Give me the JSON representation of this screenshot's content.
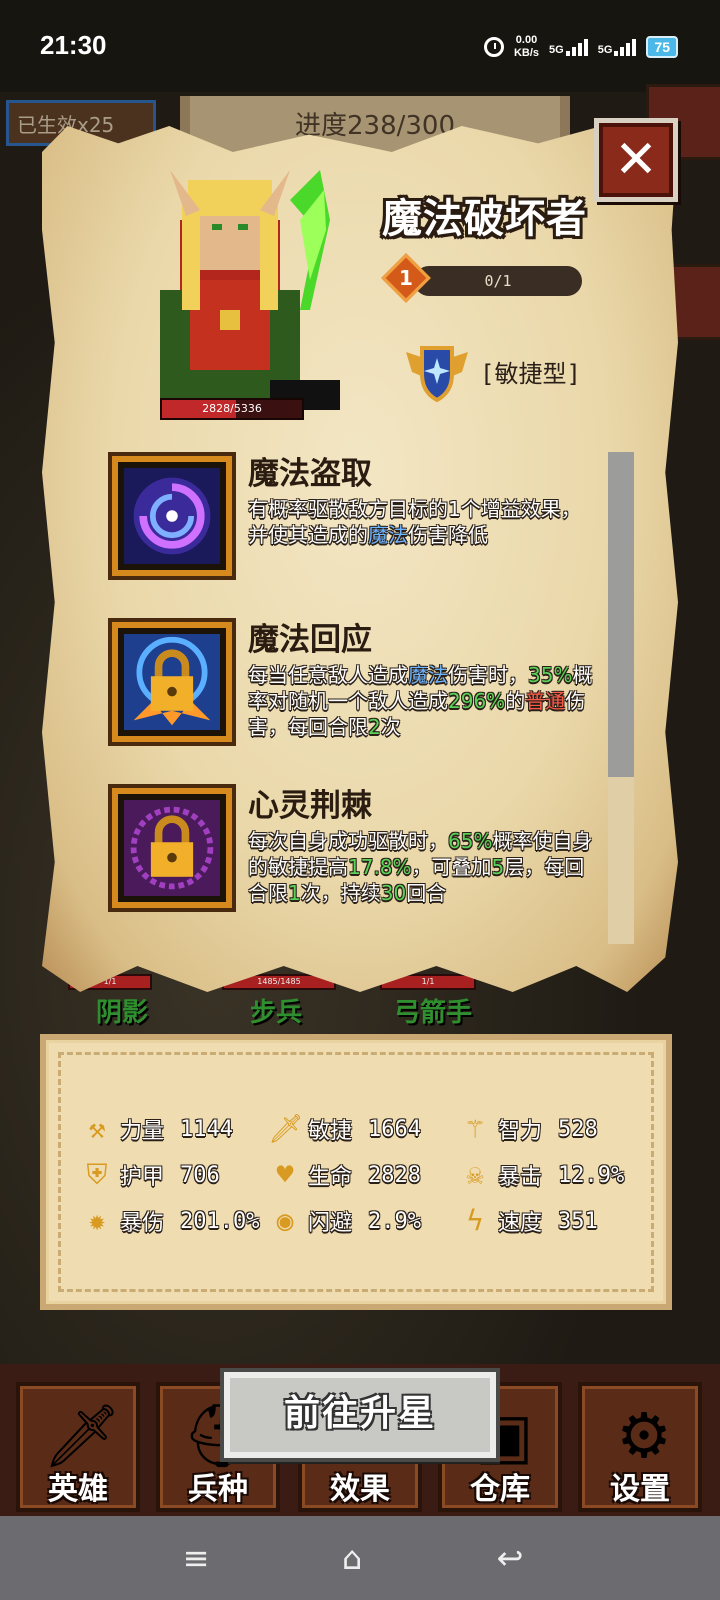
{
  "status_bar": {
    "time": "21:30",
    "net_speed_value": "0.00",
    "net_speed_unit": "KB/s",
    "signal1": "5G",
    "signal2": "5G",
    "battery": "75"
  },
  "background": {
    "effect_chip": "已生效x25",
    "progress_banner": "进度238/300",
    "units": [
      {
        "name": "阴影",
        "hp": "1/1"
      },
      {
        "name": "步兵",
        "hp": "1485/1485"
      },
      {
        "name": "弓箭手",
        "hp": "1/1"
      }
    ]
  },
  "hero": {
    "name": "魔法破坏者",
    "hp": "2828/5336",
    "hp_fraction": 0.53,
    "star_level": "1",
    "star_progress": "0/1",
    "type": "[敏捷型]"
  },
  "skills": [
    {
      "name": "魔法盗取",
      "icon": "galaxy-icon",
      "desc": [
        {
          "t": "有概率驱散敌方目标的1个增益效果，并使其造成的",
          "c": ""
        },
        {
          "t": "魔法",
          "c": "blue"
        },
        {
          "t": "伤害降低",
          "c": ""
        }
      ]
    },
    {
      "name": "魔法回应",
      "icon": "lock-burst-icon",
      "desc": [
        {
          "t": "每当任意敌人造成",
          "c": ""
        },
        {
          "t": "魔法",
          "c": "blue"
        },
        {
          "t": "伤害时，",
          "c": ""
        },
        {
          "t": "35%",
          "c": "green"
        },
        {
          "t": "概率对随机一个敌人造成",
          "c": ""
        },
        {
          "t": "296%",
          "c": "green"
        },
        {
          "t": "的",
          "c": ""
        },
        {
          "t": "普通",
          "c": "red"
        },
        {
          "t": "伤害，每回合限",
          "c": ""
        },
        {
          "t": "2",
          "c": "green"
        },
        {
          "t": "次",
          "c": ""
        }
      ]
    },
    {
      "name": "心灵荆棘",
      "icon": "lock-thorn-icon",
      "desc": [
        {
          "t": "每次自身成功驱散时，",
          "c": ""
        },
        {
          "t": "65%",
          "c": "green"
        },
        {
          "t": "概率使自身的敏捷提高",
          "c": ""
        },
        {
          "t": "17.8%",
          "c": "green"
        },
        {
          "t": "，可叠加",
          "c": ""
        },
        {
          "t": "5",
          "c": "green"
        },
        {
          "t": "层，每回合限",
          "c": ""
        },
        {
          "t": "1",
          "c": "green"
        },
        {
          "t": "次，持续",
          "c": ""
        },
        {
          "t": "30",
          "c": "green"
        },
        {
          "t": "回合",
          "c": ""
        }
      ]
    }
  ],
  "scroll_fraction_visible": 0.66,
  "stats": [
    {
      "label": "力量",
      "value": "1144",
      "icon": "axe-icon",
      "glyph": "⚒"
    },
    {
      "label": "敏捷",
      "value": "1664",
      "icon": "sword-icon",
      "glyph": "🗡"
    },
    {
      "label": "智力",
      "value": "528",
      "icon": "staff-icon",
      "glyph": "⚚"
    },
    {
      "label": "护甲",
      "value": "706",
      "icon": "shield-icon",
      "glyph": "⛨"
    },
    {
      "label": "生命",
      "value": "2828",
      "icon": "heart-icon",
      "glyph": "♥"
    },
    {
      "label": "暴击",
      "value": "12.9%",
      "icon": "skull-icon",
      "glyph": "☠"
    },
    {
      "label": "暴伤",
      "value": "201.0%",
      "icon": "burst-icon",
      "glyph": "✹"
    },
    {
      "label": "闪避",
      "value": "2.9%",
      "icon": "eye-icon",
      "glyph": "◉"
    },
    {
      "label": "速度",
      "value": "351",
      "icon": "lightning-icon",
      "glyph": "ϟ"
    }
  ],
  "upgrade_button": "前往升星",
  "bottom_nav": [
    {
      "label": "英雄",
      "icon": "sword-icon",
      "glyph": "🗡"
    },
    {
      "label": "兵种",
      "icon": "helmet-icon",
      "glyph": "⛑"
    },
    {
      "label": "效果",
      "icon": "potion-icon",
      "glyph": "⚗"
    },
    {
      "label": "仓库",
      "icon": "chest-icon",
      "glyph": "▣"
    },
    {
      "label": "设置",
      "icon": "gear-icon",
      "glyph": "⚙"
    }
  ],
  "system_nav": {
    "menu": "≡",
    "home": "⌂",
    "back": "↩"
  },
  "colors": {
    "blue": "#6fb4ff",
    "green": "#5ad25a",
    "red": "#ff5a4a",
    "parchment": "#ead8aa"
  }
}
